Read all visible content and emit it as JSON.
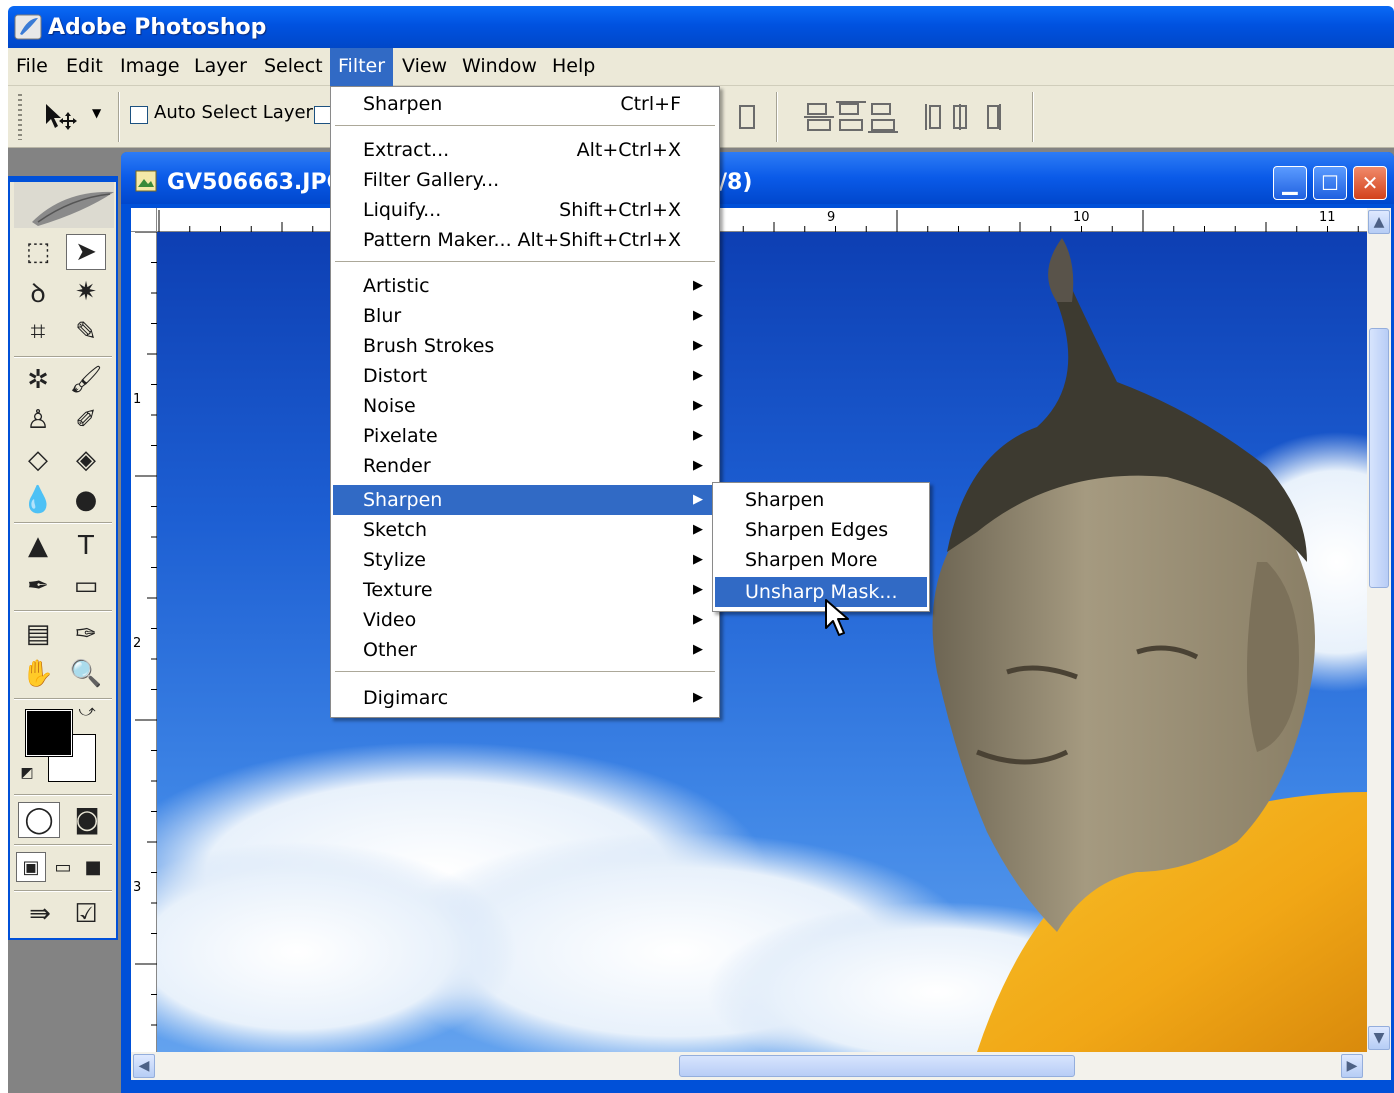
{
  "app": {
    "title": "Adobe Photoshop",
    "titlebar_color": "#0052e0"
  },
  "menubar": {
    "items": [
      {
        "label": "File"
      },
      {
        "label": "Edit"
      },
      {
        "label": "Image"
      },
      {
        "label": "Layer"
      },
      {
        "label": "Select"
      },
      {
        "label": "Filter",
        "active": true
      },
      {
        "label": "View"
      },
      {
        "label": "Window"
      },
      {
        "label": "Help"
      }
    ],
    "highlight_color": "#316ac5"
  },
  "options_bar": {
    "tool_icon": "move-tool-icon",
    "auto_select_layer_label": "Auto Select Layer",
    "auto_select_layer_checked": false
  },
  "toolbox": {
    "tools": [
      "marquee-tool-icon",
      "move-tool-icon",
      "lasso-tool-icon",
      "magic-wand-tool-icon",
      "crop-tool-icon",
      "slice-tool-icon",
      "healing-brush-tool-icon",
      "brush-tool-icon",
      "clone-stamp-tool-icon",
      "history-brush-tool-icon",
      "eraser-tool-icon",
      "paint-bucket-tool-icon",
      "blur-tool-icon",
      "dodge-tool-icon",
      "path-selection-tool-icon",
      "type-tool-icon",
      "pen-tool-icon",
      "rectangle-tool-icon",
      "notes-tool-icon",
      "eyedropper-tool-icon",
      "hand-tool-icon",
      "zoom-tool-icon"
    ],
    "foreground_color": "#000000",
    "background_color": "#ffffff"
  },
  "document": {
    "title": "GV506663.JPG",
    "title_suffix": "/8)",
    "ruler_top_labels": [
      "9",
      "10",
      "11"
    ],
    "ruler_left_labels": [
      "1",
      "2",
      "3"
    ]
  },
  "filter_menu": {
    "last_filter": {
      "label": "Sharpen",
      "shortcut": "Ctrl+F"
    },
    "group1": [
      {
        "label": "Extract...",
        "shortcut": "Alt+Ctrl+X"
      },
      {
        "label": "Filter Gallery...",
        "shortcut": ""
      },
      {
        "label": "Liquify...",
        "shortcut": "Shift+Ctrl+X"
      },
      {
        "label": "Pattern Maker...",
        "shortcut": "Alt+Shift+Ctrl+X"
      }
    ],
    "submenus": [
      {
        "label": "Artistic"
      },
      {
        "label": "Blur"
      },
      {
        "label": "Brush Strokes"
      },
      {
        "label": "Distort"
      },
      {
        "label": "Noise"
      },
      {
        "label": "Pixelate"
      },
      {
        "label": "Render"
      },
      {
        "label": "Sharpen",
        "highlighted": true
      },
      {
        "label": "Sketch"
      },
      {
        "label": "Stylize"
      },
      {
        "label": "Texture"
      },
      {
        "label": "Video"
      },
      {
        "label": "Other"
      }
    ],
    "last_group": [
      {
        "label": "Digimarc"
      }
    ]
  },
  "sharpen_submenu": {
    "items": [
      {
        "label": "Sharpen"
      },
      {
        "label": "Sharpen Edges"
      },
      {
        "label": "Sharpen More"
      },
      {
        "label": "Unsharp Mask...",
        "highlighted": true
      }
    ]
  }
}
